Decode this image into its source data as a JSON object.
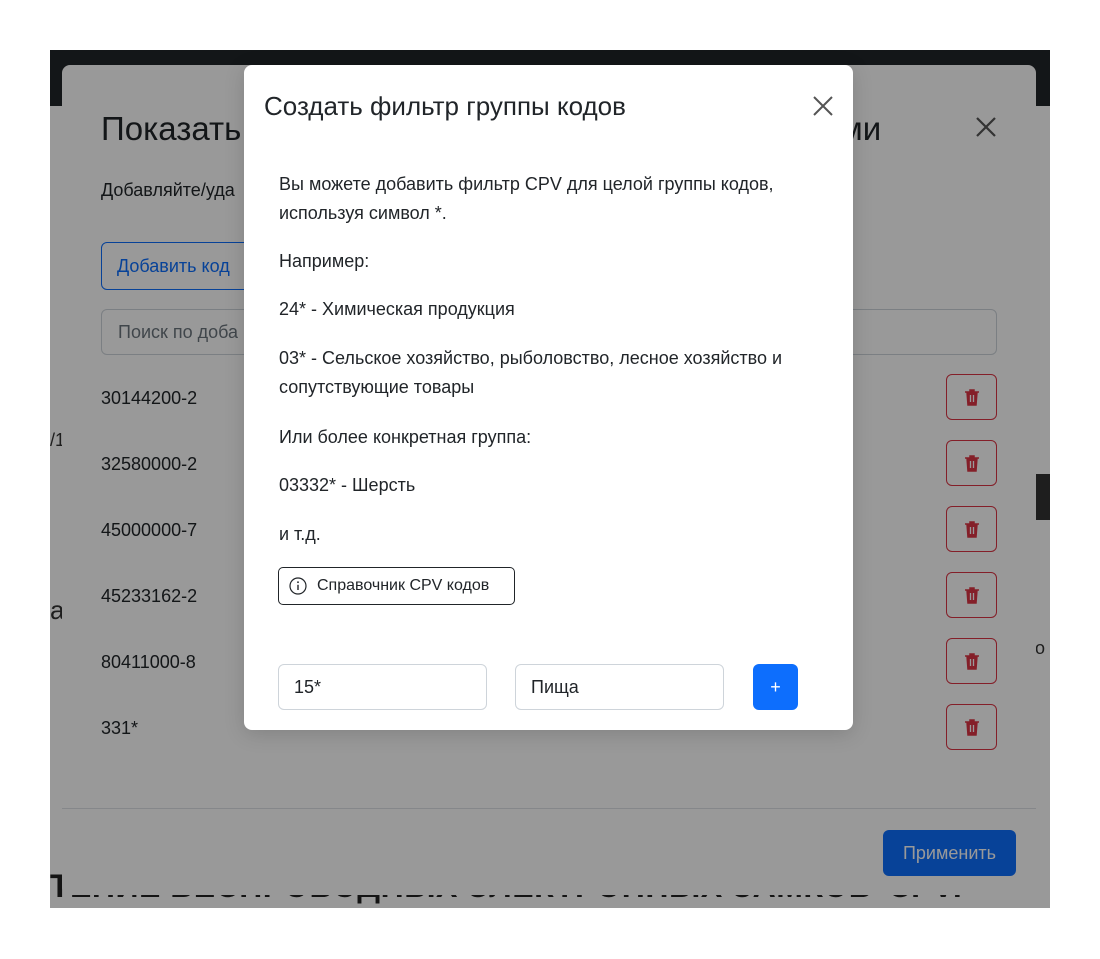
{
  "background": {
    "title_fragment": "ТЕНИЕ БЕСПРОВОДНЫХ ЭЛЕКТРОННЫХ ЗАМКОВ",
    "cpv_fragment": "CPV:"
  },
  "main_modal": {
    "title_start": "Показать",
    "title_end": "ми",
    "description": "Добавляйте/уда",
    "add_code_label": "Добавить код",
    "search_placeholder": "Поиск по доба",
    "codes": [
      "30144200-2",
      "32580000-2",
      "45000000-7",
      "45233162-2",
      "80411000-8",
      "331*"
    ],
    "apply_label": "Применить"
  },
  "group_modal": {
    "title": "Создать фильтр группы кодов",
    "intro": "Вы можете добавить фильтр CPV для целой группы кодов, используя символ *.",
    "example_heading": "Например:",
    "example_1": "24* - Химическая продукция",
    "example_2": "03* - Сельское хозяйство, рыболовство, лесное хозяйство и сопутствующие товары",
    "specific_heading": "Или более конкретная группа:",
    "example_3": "03332* - Шерсть",
    "etc": "и т.д.",
    "reference_button": "Справочник CPV кодов",
    "code_value": "15*",
    "name_value": "Пища",
    "add_button": "+"
  },
  "colors": {
    "primary": "#0d6efd",
    "danger": "#dc3545",
    "topbar": "#212529"
  }
}
